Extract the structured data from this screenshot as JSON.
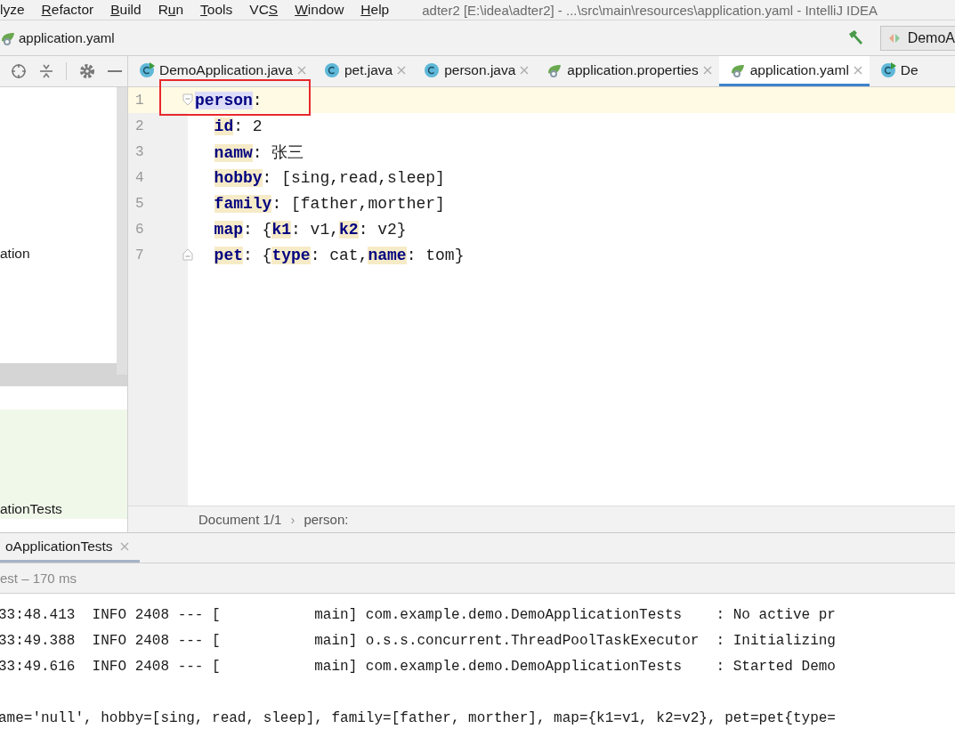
{
  "menu_bar": {
    "items": [
      {
        "label_parts": [
          {
            "text": "lyze",
            "underlined": false
          }
        ]
      },
      {
        "label_parts": [
          {
            "text": "R",
            "underlined": true
          },
          {
            "text": "efactor",
            "underlined": false
          }
        ]
      },
      {
        "label_parts": [
          {
            "text": "B",
            "underlined": true
          },
          {
            "text": "uild",
            "underlined": false
          }
        ]
      },
      {
        "label_parts": [
          {
            "text": "R",
            "underlined": false
          },
          {
            "text": "u",
            "underlined": true
          },
          {
            "text": "n",
            "underlined": false
          }
        ]
      },
      {
        "label_parts": [
          {
            "text": "T",
            "underlined": true
          },
          {
            "text": "ools",
            "underlined": false
          }
        ]
      },
      {
        "label_parts": [
          {
            "text": "VC",
            "underlined": false
          },
          {
            "text": "S",
            "underlined": true
          }
        ]
      },
      {
        "label_parts": [
          {
            "text": "W",
            "underlined": true
          },
          {
            "text": "indow",
            "underlined": false
          }
        ]
      },
      {
        "label_parts": [
          {
            "text": "H",
            "underlined": true
          },
          {
            "text": "elp",
            "underlined": false
          }
        ]
      }
    ],
    "window_title": "adter2 [E:\\idea\\adter2] - ...\\src\\main\\resources\\application.yaml - IntelliJ IDEA"
  },
  "navigation_bar": {
    "file": "application.yaml",
    "run_configuration": "DemoA"
  },
  "project_panel": {
    "items": [
      {
        "label": "ation",
        "selected": false,
        "kind": "plain"
      },
      {
        "selected": true,
        "kind": "plain"
      },
      {
        "label": "ationTests",
        "selected": false,
        "kind": "test"
      }
    ]
  },
  "editor_tabs": [
    {
      "label": "DemoApplication.java",
      "kind": "class-run",
      "selected": false,
      "closable": true
    },
    {
      "label": "pet.java",
      "kind": "class",
      "selected": false,
      "closable": true
    },
    {
      "label": "person.java",
      "kind": "class",
      "selected": false,
      "closable": true
    },
    {
      "label": "application.properties",
      "kind": "spring",
      "selected": false,
      "closable": true
    },
    {
      "label": "application.yaml",
      "kind": "spring",
      "selected": true,
      "closable": true
    },
    {
      "label": "De",
      "kind": "class-run",
      "selected": false,
      "closable": false
    }
  ],
  "editor": {
    "lines": [
      {
        "number": "1",
        "current": true,
        "boxed": true,
        "kind": "fold-start",
        "tokens": [
          {
            "kind": "key-at-caret",
            "text": "person"
          },
          {
            "kind": "plain",
            "text": ":"
          }
        ],
        "children": [
          {
            "number": "2",
            "current": false,
            "boxed": false,
            "kind": "plain",
            "tokens": [
              {
                "kind": "key",
                "text": "id"
              },
              {
                "kind": "plain",
                "text": ": 2"
              }
            ]
          },
          {
            "number": "3",
            "current": false,
            "boxed": false,
            "kind": "plain",
            "tokens": [
              {
                "kind": "key",
                "text": "namw"
              },
              {
                "kind": "plain",
                "text": ": 张三"
              }
            ]
          },
          {
            "number": "4",
            "current": false,
            "boxed": false,
            "kind": "plain",
            "tokens": [
              {
                "kind": "key",
                "text": "hobby"
              },
              {
                "kind": "plain",
                "text": ": [sing,read,sleep]"
              }
            ]
          },
          {
            "number": "5",
            "current": false,
            "boxed": false,
            "kind": "plain",
            "tokens": [
              {
                "kind": "key",
                "text": "family"
              },
              {
                "kind": "plain",
                "text": ": [father,morther]"
              }
            ]
          },
          {
            "number": "6",
            "current": false,
            "boxed": false,
            "kind": "plain",
            "tokens": [
              {
                "kind": "key",
                "text": "map"
              },
              {
                "kind": "plain",
                "text": ": {"
              },
              {
                "kind": "key",
                "text": "k1"
              },
              {
                "kind": "plain",
                "text": ": v1,"
              },
              {
                "kind": "key",
                "text": "k2"
              },
              {
                "kind": "plain",
                "text": ": v2}"
              }
            ]
          },
          {
            "number": "7",
            "current": false,
            "boxed": false,
            "kind": "fold-end",
            "tokens": [
              {
                "kind": "key",
                "text": "pet"
              },
              {
                "kind": "plain",
                "text": ": {"
              },
              {
                "kind": "key",
                "text": "type"
              },
              {
                "kind": "plain",
                "text": ": cat,"
              },
              {
                "kind": "key",
                "text": "name"
              },
              {
                "kind": "plain",
                "text": ": tom}"
              }
            ]
          }
        ]
      }
    ],
    "breadcrumbs": [
      {
        "kind": "crumb",
        "text": "Document 1/1"
      },
      {
        "kind": "separator",
        "text": "›"
      },
      {
        "kind": "crumb",
        "text": "person:"
      }
    ]
  },
  "run_panel": {
    "tab": "oApplicationTests",
    "status": "est – 170 ms",
    "console_lines": [
      {
        "kind": "log",
        "text": "33:48.413  INFO 2408 --- [           main] com.example.demo.DemoApplicationTests    : No active pr"
      },
      {
        "kind": "log",
        "text": "33:49.388  INFO 2408 --- [           main] o.s.s.concurrent.ThreadPoolTaskExecutor  : Initializing"
      },
      {
        "kind": "log",
        "text": "33:49.616  INFO 2408 --- [           main] com.example.demo.DemoApplicationTests    : Started Demo"
      },
      {
        "kind": "output",
        "text": "ame='null', hobby=[sing, read, sleep], family=[father, morther], map={k1=v1, k2=v2}, pet=pet{type="
      }
    ]
  }
}
